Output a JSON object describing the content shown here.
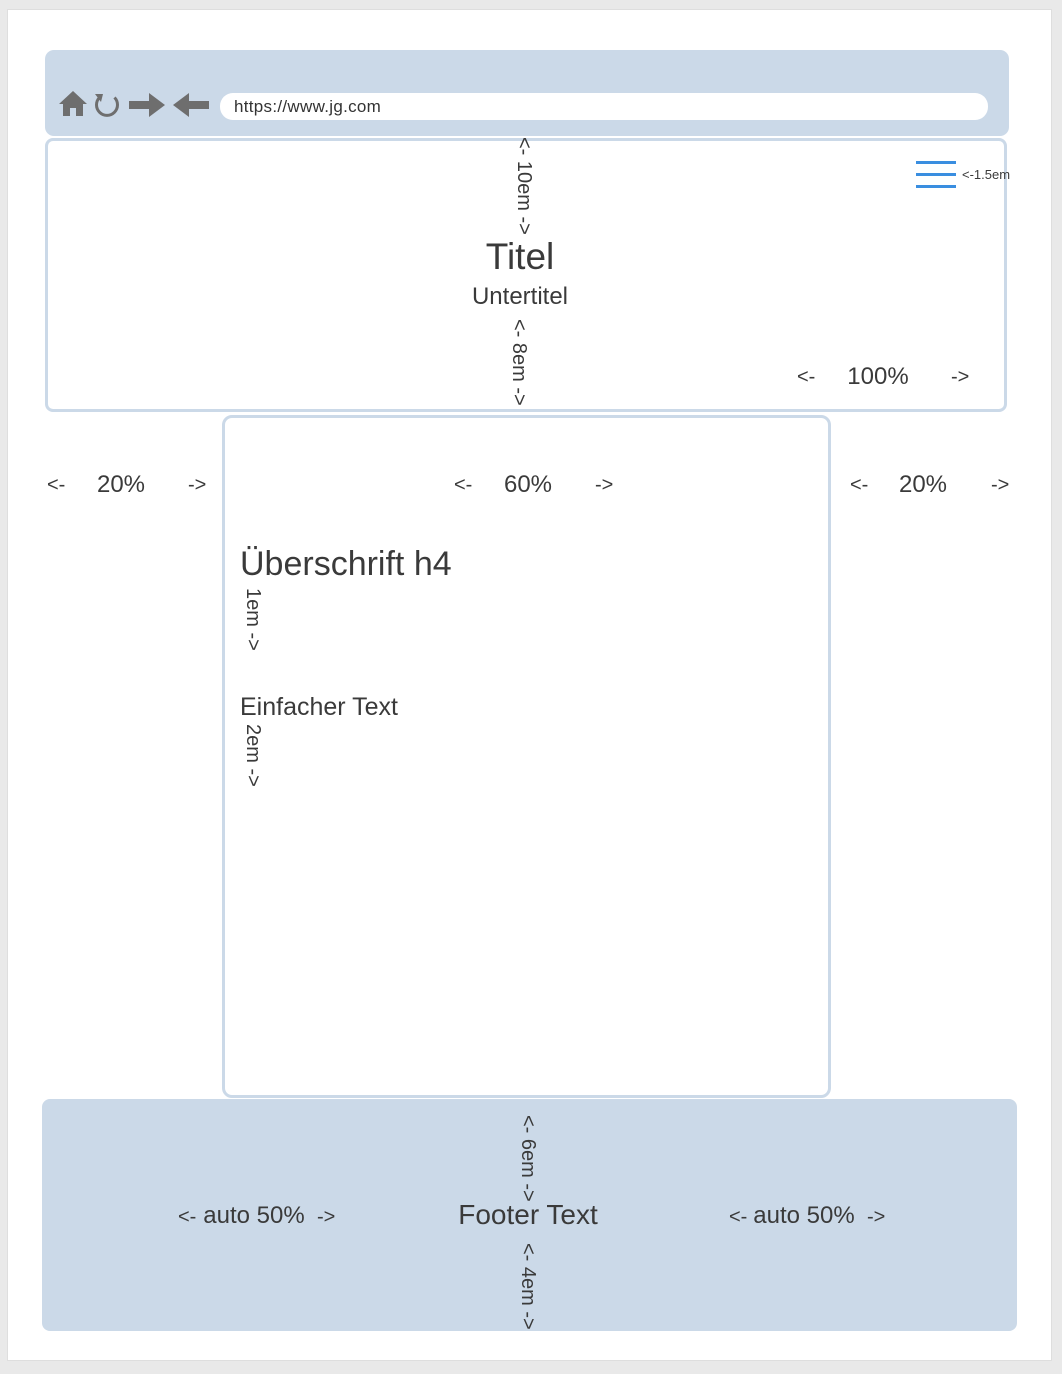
{
  "browser": {
    "icons": [
      "home-icon",
      "reload-icon",
      "forward-arrow-icon",
      "back-arrow-icon"
    ],
    "url": "https://www.jg.com"
  },
  "header": {
    "top_spacing": "<- 10em ->",
    "title": "Titel",
    "subtitle": "Untertitel",
    "bottom_spacing": "<- 8em ->",
    "width_label": {
      "left": "<-",
      "value": "100%",
      "right": "->"
    },
    "menu_icon": "hamburger-menu-icon",
    "menu_size_label": "<-1.5em"
  },
  "columns": {
    "left": {
      "left": "<-",
      "value": "20%",
      "right": "->"
    },
    "center": {
      "left": "<-",
      "value": "60%",
      "right": "->"
    },
    "right": {
      "left": "<-",
      "value": "20%",
      "right": "->"
    }
  },
  "content": {
    "heading": "Überschrift h4",
    "heading_spacing": "1em ->",
    "text": "Einfacher Text",
    "text_spacing": "2em ->"
  },
  "footer": {
    "top_spacing": "<- 6em ->",
    "text": "Footer Text",
    "bottom_spacing": "<- 4em ->",
    "left_label": {
      "left": "<-",
      "value": "auto 50%",
      "right": "->"
    },
    "right_label": {
      "left": "<-",
      "value": "auto 50%",
      "right": "->"
    }
  },
  "colors": {
    "panel": "#cbd9e8",
    "menu_icon": "#3a8ee0",
    "nav_icons": "#6e6e6e"
  }
}
